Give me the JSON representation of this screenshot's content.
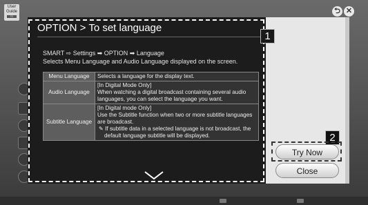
{
  "guide_badge": {
    "line1": "User",
    "line2": "Guide",
    "tiny": "≡≡"
  },
  "window_controls": {
    "back_glyph": "⮌",
    "close_glyph": "✕"
  },
  "dialog": {
    "title": "OPTION > To set language",
    "path_text": "SMART ⇨ Settings ➡ OPTION ➡ Language",
    "description": "Selects Menu Language and Audio Language displayed on the screen.",
    "rows": [
      {
        "key": "Menu Language",
        "lines": [
          "Selects a language for the display text."
        ],
        "note": ""
      },
      {
        "key": "Audio Language",
        "lines": [
          "[In Digital Mode Only]",
          "When watching a digital broadcast containing several audio languages, you can select the language you want."
        ],
        "note": ""
      },
      {
        "key": "Subtitle Language",
        "lines": [
          "[In Digital mode Only]",
          "Use the Subtitle function when two or more subtitle languages are broadcast."
        ],
        "note": "✎ If subtitle data in a selected language is not broadcast, the default language subtitle will be displayed."
      }
    ]
  },
  "markers": {
    "marker1": "1",
    "marker2": "2"
  },
  "buttons": {
    "try_now": "Try Now",
    "close": "Close"
  },
  "icons": {
    "scroll_down": "chevron-down-icon"
  }
}
